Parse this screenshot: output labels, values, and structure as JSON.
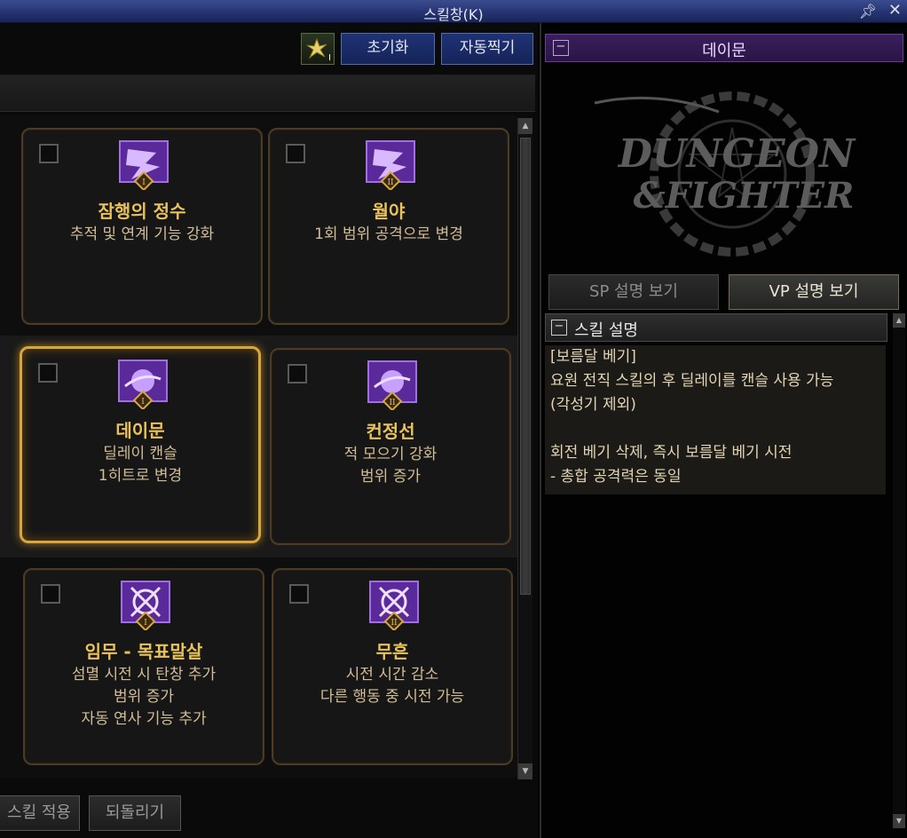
{
  "window": {
    "title": "스킬창(K)",
    "pin_icon": "pin-icon",
    "close_icon": "close-icon"
  },
  "toolbar": {
    "icon": "skill-tree-icon",
    "icon_sub": "I",
    "reset_label": "초기화",
    "auto_label": "자동찍기"
  },
  "skills": [
    {
      "name": "잠행의 정수",
      "desc": [
        "추적 및 연계 기능 강화"
      ],
      "tier": "I",
      "selected": false
    },
    {
      "name": "월야",
      "desc": [
        "1회 범위 공격으로 변경"
      ],
      "tier": "II",
      "selected": false
    },
    {
      "name": "데이문",
      "desc": [
        "딜레이 캔슬",
        "1히트로 변경"
      ],
      "tier": "I",
      "selected": true
    },
    {
      "name": "컨정선",
      "desc": [
        "적 모으기 강화",
        "범위 증가"
      ],
      "tier": "II",
      "selected": false
    },
    {
      "name": "임무 - 목표말살",
      "desc": [
        "섬멸 시전 시 탄창 추가",
        "범위 증가",
        "자동 연사 기능 추가"
      ],
      "tier": "I",
      "selected": false
    },
    {
      "name": "무흔",
      "desc": [
        "시전 시간 감소",
        "다른 행동 중 시전 가능"
      ],
      "tier": "II",
      "selected": false
    }
  ],
  "footer": {
    "apply_label": "스킬 적용",
    "revert_label": "되돌리기"
  },
  "detail": {
    "header_title": "데이문",
    "collapse_glyph": "−",
    "logo_text_1": "DUNGEON",
    "logo_text_2": "&FIGHTER",
    "tab_sp": "SP 설명 보기",
    "tab_vp": "VP 설명 보기",
    "section_title": "스킬 설명",
    "description_lines": [
      "[보름달 베기]",
      "요원 전직 스킬의 후 딜레이를 캔슬 사용 가능",
      "(각성기 제외)",
      "",
      "회전 베기 삭제, 즉시 보름달 베기 시전",
      "- 총합 공격력은 동일"
    ]
  },
  "colors": {
    "title_bar": "#233270",
    "accent_gold": "#e9c25a",
    "selected_border": "#d6a640",
    "purple_header": "#3a1f5c"
  }
}
